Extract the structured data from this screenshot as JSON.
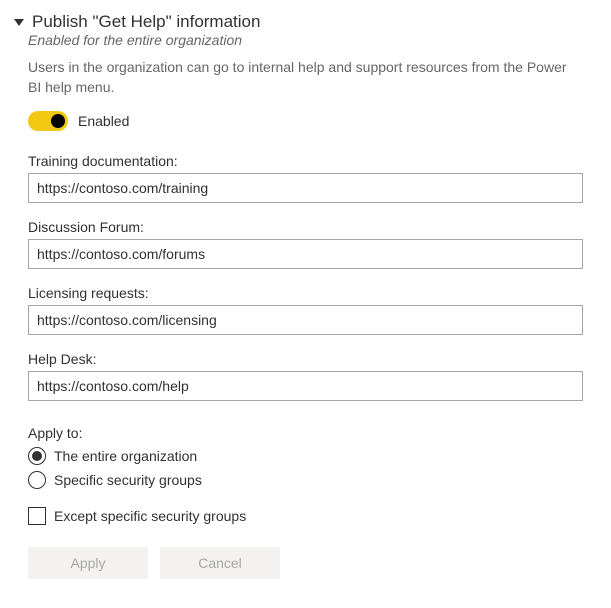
{
  "header": {
    "title": "Publish \"Get Help\" information",
    "subtitle": "Enabled for the entire organization",
    "description": "Users in the organization can go to internal help and support resources from the Power BI help menu."
  },
  "toggle": {
    "label": "Enabled",
    "on": true
  },
  "fields": {
    "training": {
      "label": "Training documentation:",
      "value": "https://contoso.com/training"
    },
    "forum": {
      "label": "Discussion Forum:",
      "value": "https://contoso.com/forums"
    },
    "licensing": {
      "label": "Licensing requests:",
      "value": "https://contoso.com/licensing"
    },
    "helpdesk": {
      "label": "Help Desk:",
      "value": "https://contoso.com/help"
    }
  },
  "applyTo": {
    "label": "Apply to:",
    "options": {
      "entire": "The entire organization",
      "specific": "Specific security groups"
    },
    "except": "Except specific security groups"
  },
  "buttons": {
    "apply": "Apply",
    "cancel": "Cancel"
  }
}
